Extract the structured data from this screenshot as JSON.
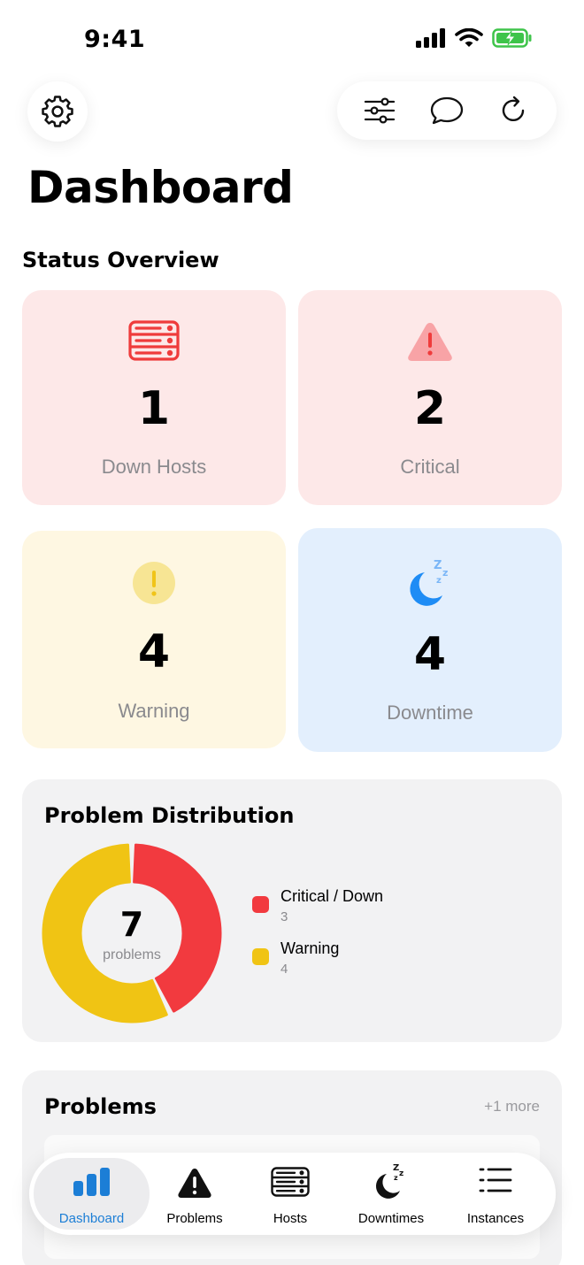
{
  "status_bar": {
    "time": "9:41"
  },
  "header": {
    "title": "Dashboard",
    "icons": [
      "gear-icon",
      "sliders-icon",
      "chat-bubble-icon",
      "refresh-icon"
    ]
  },
  "status_overview": {
    "title": "Status Overview",
    "cards": [
      {
        "key": "down_hosts",
        "value": "1",
        "label": "Down Hosts",
        "icon": "server-icon",
        "bg": "#fde8e8",
        "accent": "#ef3b3b"
      },
      {
        "key": "critical",
        "value": "2",
        "label": "Critical",
        "icon": "warning-triangle-icon",
        "bg": "#fde8e8",
        "accent": "#ef3b3b"
      },
      {
        "key": "warning",
        "value": "4",
        "label": "Warning",
        "icon": "exclamation-circle-icon",
        "bg": "#fef7e2",
        "accent": "#f0c419"
      },
      {
        "key": "downtime",
        "value": "4",
        "label": "Downtime",
        "icon": "moon-sleep-icon",
        "bg": "#e3effd",
        "accent": "#1e8cf5"
      }
    ]
  },
  "distribution": {
    "title": "Problem Distribution",
    "total": "7",
    "total_label": "problems",
    "items": [
      {
        "label": "Critical / Down",
        "count": "3",
        "value": 3,
        "color": "#f23a3f"
      },
      {
        "label": "Warning",
        "count": "4",
        "value": 4,
        "color": "#f0c414"
      }
    ]
  },
  "problems": {
    "title": "Problems",
    "more": "+1 more"
  },
  "tabbar": {
    "active": "Dashboard",
    "tabs": [
      {
        "label": "Dashboard",
        "icon": "bar-chart-icon"
      },
      {
        "label": "Problems",
        "icon": "warning-triangle-icon"
      },
      {
        "label": "Hosts",
        "icon": "server-icon"
      },
      {
        "label": "Downtimes",
        "icon": "moon-sleep-icon"
      },
      {
        "label": "Instances",
        "icon": "list-icon"
      }
    ]
  },
  "colors": {
    "accent": "#1c7ed6",
    "critical": "#f23a3f",
    "warning": "#f0c414",
    "downtime": "#1e8cf5"
  }
}
